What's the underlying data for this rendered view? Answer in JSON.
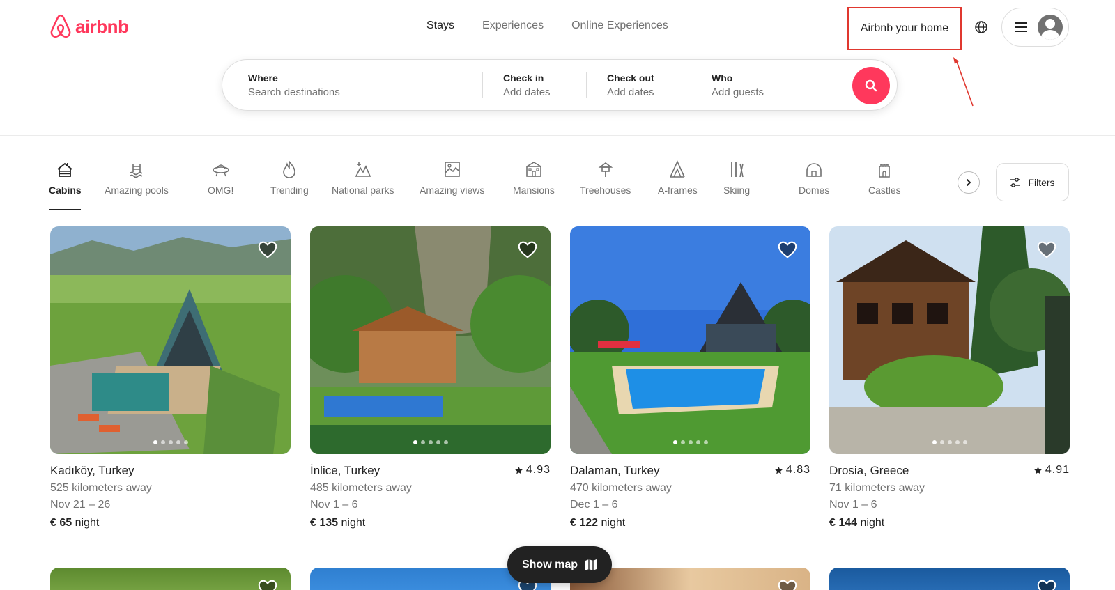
{
  "brand": {
    "name": "airbnb",
    "color": "#ff385c"
  },
  "nav": {
    "tabs": [
      "Stays",
      "Experiences",
      "Online Experiences"
    ],
    "active": "Stays"
  },
  "header": {
    "host_label": "Airbnb your home"
  },
  "search": {
    "where": {
      "title": "Where",
      "placeholder": "Search destinations"
    },
    "check_in": {
      "title": "Check in",
      "placeholder": "Add dates"
    },
    "check_out": {
      "title": "Check out",
      "placeholder": "Add dates"
    },
    "who": {
      "title": "Who",
      "placeholder": "Add guests"
    }
  },
  "categories": [
    {
      "label": "Cabins",
      "icon": "cabin-icon",
      "active": true
    },
    {
      "label": "Amazing pools",
      "icon": "pool-icon"
    },
    {
      "label": "OMG!",
      "icon": "ufo-icon"
    },
    {
      "label": "Trending",
      "icon": "flame-icon"
    },
    {
      "label": "National parks",
      "icon": "national-park-icon"
    },
    {
      "label": "Amazing views",
      "icon": "view-icon"
    },
    {
      "label": "Mansions",
      "icon": "mansion-icon"
    },
    {
      "label": "Treehouses",
      "icon": "treehouse-icon"
    },
    {
      "label": "A-frames",
      "icon": "a-frame-icon"
    },
    {
      "label": "Skiing",
      "icon": "ski-icon"
    },
    {
      "label": "Domes",
      "icon": "dome-icon"
    },
    {
      "label": "Castles",
      "icon": "castle-icon"
    }
  ],
  "filters_label": "Filters",
  "listings": [
    {
      "location": "Kadıköy, Turkey",
      "rating": "",
      "distance": "525 kilometers away",
      "dates": "Nov 21 – 26",
      "price": "€ 65",
      "unit": "night"
    },
    {
      "location": "İnlice, Turkey",
      "rating": "4.93",
      "distance": "485 kilometers away",
      "dates": "Nov 1 – 6",
      "price": "€ 135",
      "unit": "night"
    },
    {
      "location": "Dalaman, Turkey",
      "rating": "4.83",
      "distance": "470 kilometers away",
      "dates": "Dec 1 – 6",
      "price": "€ 122",
      "unit": "night"
    },
    {
      "location": "Drosia, Greece",
      "rating": "4.91",
      "distance": "71 kilometers away",
      "dates": "Nov 1 – 6",
      "price": "€ 144",
      "unit": "night"
    }
  ],
  "show_map_label": "Show map",
  "colors": {
    "accent": "#ff385c",
    "annotation": "#e0382f",
    "text": "#222222",
    "muted": "#717171"
  }
}
